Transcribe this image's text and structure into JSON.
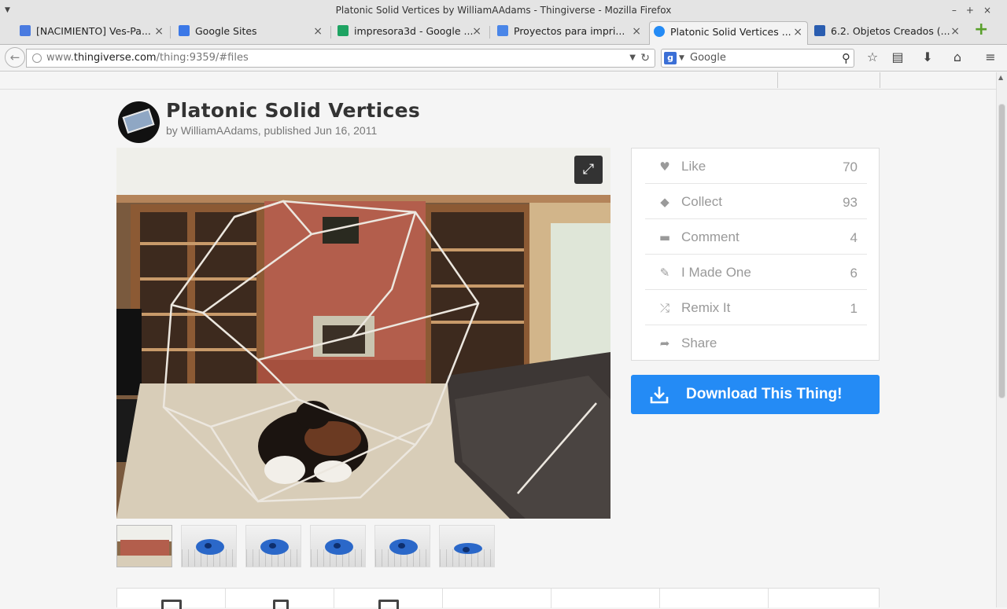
{
  "window": {
    "title": "Platonic Solid Vertices by WilliamAAdams - Thingiverse - Mozilla Firefox"
  },
  "tabs": [
    {
      "label": "[NACIMIENTO] Ves-Pa...",
      "favicon_color": "#4a7be0",
      "active": false
    },
    {
      "label": "Google Sites",
      "favicon_color": "#3b78e7",
      "active": false
    },
    {
      "label": "impresora3d - Google ...",
      "favicon_color": "#1ea362",
      "active": false
    },
    {
      "label": "Proyectos para impri...",
      "favicon_color": "#4a86e8",
      "active": false
    },
    {
      "label": "Platonic Solid Vertices ...",
      "favicon_color": "#248bf5",
      "active": true
    },
    {
      "label": "6.2. Objetos Creados (...",
      "favicon_color": "#2a5db0",
      "active": false
    }
  ],
  "navbar": {
    "url_prefix": "www.",
    "url_domain": "thingiverse.com",
    "url_path": "/thing:9359/#files",
    "search_placeholder": "Google"
  },
  "thing": {
    "title": "Platonic Solid Vertices",
    "by_prefix": "by",
    "author": "WilliamAAdams",
    "published": ", published Jun 16, 2011"
  },
  "actions": [
    {
      "label": "Like",
      "count": "70",
      "icon": "heart-icon",
      "glyph": "♥"
    },
    {
      "label": "Collect",
      "count": "93",
      "icon": "collect-icon",
      "glyph": "◆"
    },
    {
      "label": "Comment",
      "count": "4",
      "icon": "comment-icon",
      "glyph": "▬"
    },
    {
      "label": "I Made One",
      "count": "6",
      "icon": "made-icon",
      "glyph": "✎"
    },
    {
      "label": "Remix It",
      "count": "1",
      "icon": "remix-icon",
      "glyph": "⤮"
    },
    {
      "label": "Share",
      "count": "",
      "icon": "share-icon",
      "glyph": "➦"
    }
  ],
  "download": {
    "label": "Download This Thing!"
  },
  "colors": {
    "accent": "#248bf5",
    "thumb_part": "#2b68c9"
  }
}
